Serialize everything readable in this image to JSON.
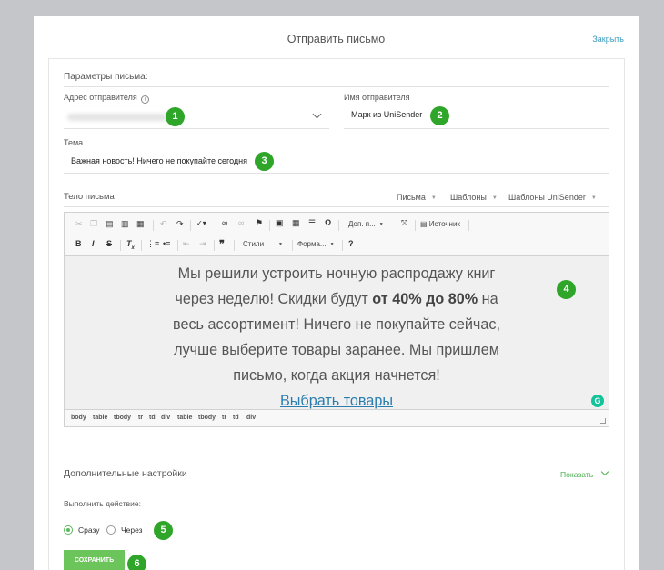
{
  "header": {
    "title": "Отправить письмо",
    "close_label": "Закрыть"
  },
  "params": {
    "title": "Параметры письма:"
  },
  "sender_address": {
    "label": "Адрес отправителя",
    "info_icon": "i"
  },
  "sender_name": {
    "label": "Имя отправителя",
    "value": "Марк из UniSender"
  },
  "subject": {
    "label": "Тема",
    "value": "Важная новость! Ничего не покупайте сегодня"
  },
  "body": {
    "label": "Тело письма",
    "tabs": [
      "Письма",
      "Шаблоны",
      "Шаблоны UniSender"
    ],
    "toolbar": {
      "doc_props": "Доп. п...",
      "source": "Источник",
      "styles": "Стили",
      "format": "Форма...",
      "help": "?"
    },
    "content": {
      "line1": "Мы решили устроить ночную распродажу книг",
      "line2_pre": "через неделю! Скидки будут ",
      "line2_bold": "от 40% до 80%",
      "line2_post": " на",
      "line3": "весь ассортимент! Ничего не покупайте сейчас,",
      "line4": "лучше выберите товары заранее. Мы пришлем",
      "line5": "письмо, когда акция начнется!",
      "link": "Выбрать товары"
    },
    "grammarly": "G",
    "path": [
      "body",
      "table",
      "tbody",
      "tr",
      "td",
      "div",
      "table",
      "tbody",
      "tr",
      "td",
      "div"
    ]
  },
  "additional": {
    "title": "Дополнительные настройки",
    "toggle_label": "Показать"
  },
  "action": {
    "label": "Выполнить действие:",
    "options": [
      "Сразу",
      "Через"
    ],
    "selected": "Сразу"
  },
  "save_label": "СОХРАНИТЬ",
  "badges": [
    "1",
    "2",
    "3",
    "4",
    "5",
    "6"
  ],
  "colors": {
    "accent_green": "#2fa52a",
    "button_green": "#6cc55b",
    "link_blue": "#2a7dad"
  }
}
